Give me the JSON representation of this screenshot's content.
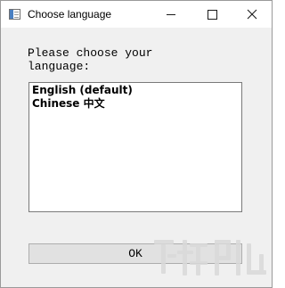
{
  "window": {
    "title": "Choose language",
    "controls": {
      "minimize_icon": "minimize-icon",
      "maximize_icon": "maximize-icon",
      "close_icon": "close-icon"
    }
  },
  "dialog": {
    "prompt": "Please choose your\nlanguage:",
    "languages": [
      "English (default)",
      "Chinese 中文"
    ],
    "ok_label": "OK"
  },
  "colors": {
    "titlebar": "#ffffff",
    "dialog_bg": "#f0f0f0",
    "button_bg": "#e1e1e1",
    "watermark": "#d9d9d9"
  }
}
